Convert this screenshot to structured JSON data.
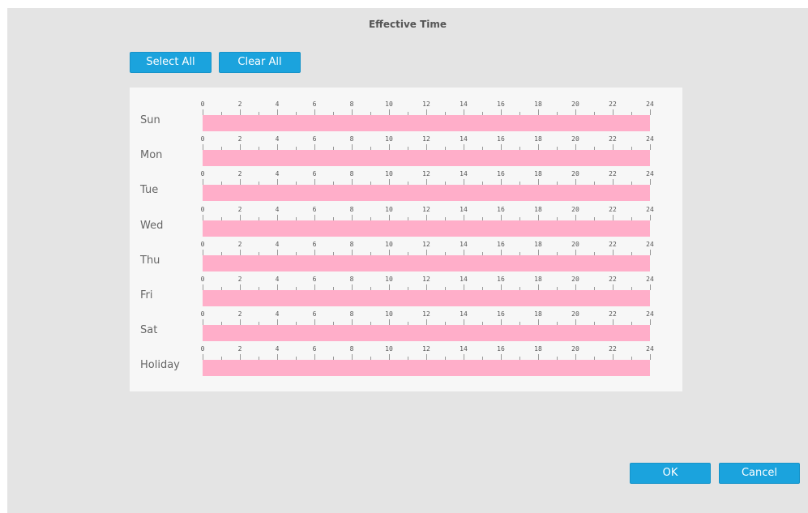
{
  "dialog": {
    "title": "Effective Time",
    "select_all_label": "Select All",
    "clear_all_label": "Clear All",
    "ok_label": "OK",
    "cancel_label": "Cancel"
  },
  "schedule": {
    "hour_labels": [
      "0",
      "2",
      "4",
      "6",
      "8",
      "10",
      "12",
      "14",
      "16",
      "18",
      "20",
      "22",
      "24"
    ],
    "days": [
      {
        "label": "Sun"
      },
      {
        "label": "Mon"
      },
      {
        "label": "Tue"
      },
      {
        "label": "Wed"
      },
      {
        "label": "Thu"
      },
      {
        "label": "Fri"
      },
      {
        "label": "Sat"
      },
      {
        "label": "Holiday"
      }
    ],
    "active_color": "#ffaec9",
    "selected_hours_fraction": 1.0
  },
  "colors": {
    "button": "#1ba3dd",
    "background": "#e4e4e4",
    "panel": "#f7f7f7"
  }
}
